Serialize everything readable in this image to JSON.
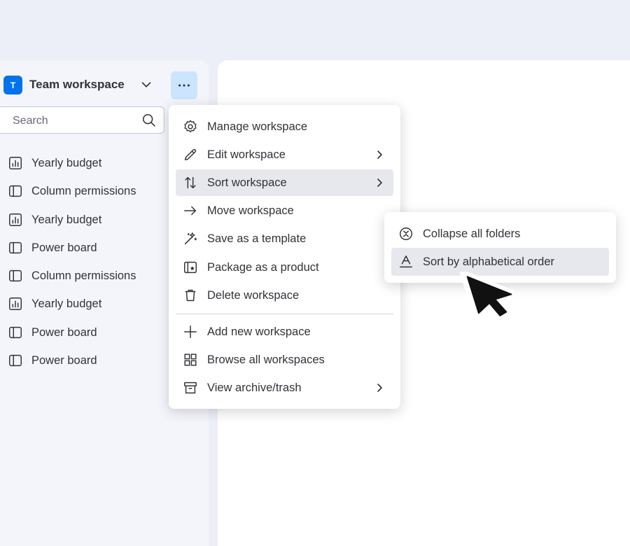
{
  "workspace": {
    "avatar_letter": "T",
    "name": "Team workspace",
    "more_label": "···"
  },
  "search": {
    "placeholder": "Search"
  },
  "boards": [
    {
      "label": "Yearly budget",
      "icon": "chart-board-icon"
    },
    {
      "label": "Column permissions",
      "icon": "board-icon"
    },
    {
      "label": "Yearly budget",
      "icon": "chart-board-icon"
    },
    {
      "label": "Power board",
      "icon": "board-icon"
    },
    {
      "label": "Column permissions",
      "icon": "board-icon"
    },
    {
      "label": "Yearly budget",
      "icon": "chart-board-icon"
    },
    {
      "label": "Power board",
      "icon": "board-icon"
    },
    {
      "label": "Power board",
      "icon": "board-icon"
    }
  ],
  "menu": {
    "items": [
      {
        "label": "Manage workspace",
        "icon": "gear-icon"
      },
      {
        "label": "Edit workspace",
        "icon": "pencil-icon",
        "has_submenu": true
      },
      {
        "label": "Sort workspace",
        "icon": "sort-icon",
        "has_submenu": true,
        "active": true
      },
      {
        "label": "Move workspace",
        "icon": "arrow-right-icon"
      },
      {
        "label": "Save as a template",
        "icon": "magic-wand-icon"
      },
      {
        "label": "Package as a product",
        "icon": "package-icon"
      },
      {
        "label": "Delete workspace",
        "icon": "trash-icon"
      },
      {
        "label": "Add new workspace",
        "icon": "plus-icon"
      },
      {
        "label": "Browse all workspaces",
        "icon": "grid-icon"
      },
      {
        "label": "View archive/trash",
        "icon": "archive-icon",
        "has_submenu": true
      }
    ]
  },
  "submenu": {
    "items": [
      {
        "label": "Collapse all folders",
        "icon": "collapse-icon"
      },
      {
        "label": "Sort by alphabetical order",
        "icon": "alphabet-icon",
        "active": true
      }
    ]
  },
  "colors": {
    "accent": "#0073ea",
    "accent_light": "#cce5ff",
    "active_row": "#e7e8ed"
  }
}
